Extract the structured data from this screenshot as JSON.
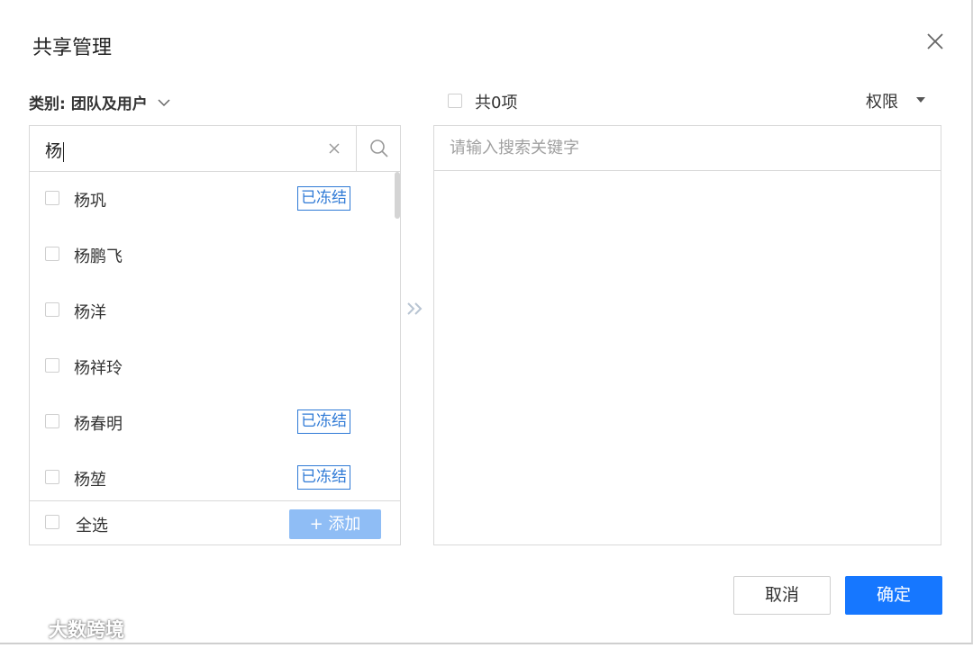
{
  "dialog": {
    "title": "共享管理",
    "category_label": "类别:",
    "category_value": "团队及用户",
    "close_icon": "close-icon"
  },
  "left": {
    "search_value": "杨",
    "clear_icon": "clear-icon",
    "search_icon": "search-icon",
    "items": [
      {
        "name": "杨巩",
        "badge": "已冻结"
      },
      {
        "name": "杨鹏飞",
        "badge": ""
      },
      {
        "name": "杨洋",
        "badge": ""
      },
      {
        "name": "杨祥玲",
        "badge": ""
      },
      {
        "name": "杨春明",
        "badge": "已冻结"
      },
      {
        "name": "杨堃",
        "badge": "已冻结"
      }
    ],
    "select_all": "全选",
    "add_button": "+ 添加"
  },
  "transfer_icon": "double-chevron-right-icon",
  "right": {
    "total": "共0项",
    "permission": "权限",
    "search_placeholder": "请输入搜索关键字"
  },
  "actions": {
    "cancel": "取消",
    "confirm": "确定"
  },
  "watermark": "大数跨境",
  "colors": {
    "primary": "#1677ff",
    "add_disabled": "#8fbdf5",
    "badge": "#2f7ad6",
    "border": "#d9d9d9"
  }
}
